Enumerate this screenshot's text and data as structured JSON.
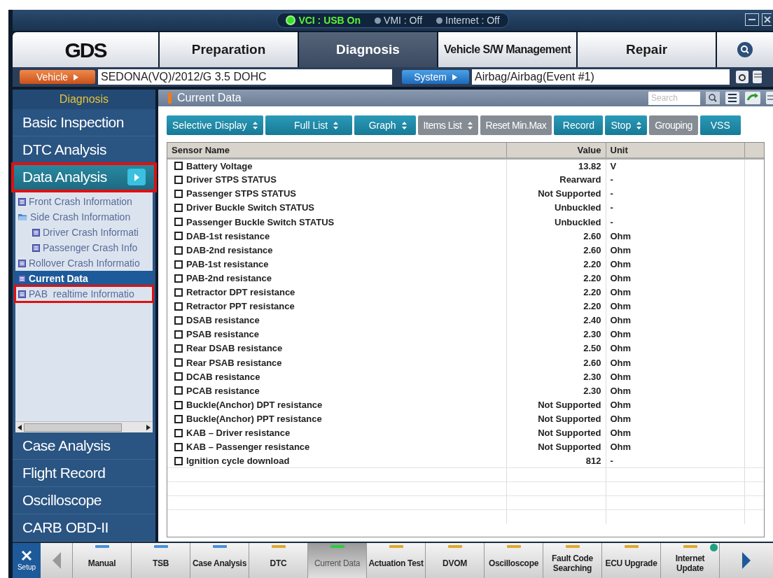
{
  "status_bar": {
    "indicators": [
      {
        "label": "VCI : USB On",
        "on": true
      },
      {
        "label": "VMI : Off",
        "on": false
      },
      {
        "label": "Internet : Off",
        "on": false
      }
    ]
  },
  "logo": "GDS",
  "tabs": [
    {
      "label": "Preparation",
      "selected": false
    },
    {
      "label": "Diagnosis",
      "selected": true
    },
    {
      "label": "Vehicle S/W Management",
      "selected": false
    },
    {
      "label": "Repair",
      "selected": false
    }
  ],
  "vehicle_bar": {
    "vehicle_button": "Vehicle",
    "vehicle_value": "SEDONA(VQ)/2012/G 3.5 DOHC",
    "system_button": "System",
    "system_value": "Airbag/Airbag(Event #1)"
  },
  "sidebar": {
    "title": "Diagnosis",
    "top_items": [
      {
        "label": "Basic Inspection",
        "selected": false,
        "highlighted": false
      },
      {
        "label": "DTC Analysis",
        "selected": false,
        "highlighted": false
      },
      {
        "label": "Data Analysis",
        "selected": true,
        "highlighted": true
      }
    ],
    "tree": [
      {
        "label": "Front Crash Information",
        "kind": "item",
        "selected": false,
        "highlighted": false
      },
      {
        "label": "Side Crash Information",
        "kind": "folder",
        "selected": false,
        "highlighted": false,
        "children": [
          {
            "label": "Driver Crash Informati",
            "kind": "item",
            "selected": false,
            "highlighted": false
          },
          {
            "label": "Passenger Crash Info",
            "kind": "item",
            "selected": false,
            "highlighted": false
          }
        ]
      },
      {
        "label": "Rollover Crash Informatio",
        "kind": "item",
        "selected": false,
        "highlighted": false
      },
      {
        "label": "Current Data",
        "kind": "item",
        "selected": true,
        "highlighted": false
      },
      {
        "label": "PAB  realtime Informatio",
        "kind": "item",
        "selected": false,
        "highlighted": true
      }
    ],
    "bottom_items": [
      {
        "label": "Case Analysis"
      },
      {
        "label": "Flight Record"
      },
      {
        "label": "Oscilloscope"
      },
      {
        "label": "CARB OBD-II"
      }
    ]
  },
  "panel": {
    "title": "Current Data",
    "search": {
      "placeholder": "Search"
    }
  },
  "toolbar": [
    {
      "label": "Selective Display",
      "dropdown": true,
      "disabled": false
    },
    {
      "label": "Full List",
      "dropdown": true,
      "disabled": false
    },
    {
      "label": "Graph",
      "dropdown": true,
      "disabled": false
    },
    {
      "label": "Items List",
      "dropdown": true,
      "disabled": true
    },
    {
      "label": "Reset Min.Max",
      "dropdown": false,
      "disabled": true
    },
    {
      "label": "Record",
      "dropdown": false,
      "disabled": false
    },
    {
      "label": "Stop",
      "dropdown": true,
      "disabled": false
    },
    {
      "label": "Grouping",
      "dropdown": false,
      "disabled": true
    },
    {
      "label": "VSS",
      "dropdown": false,
      "disabled": false
    }
  ],
  "table": {
    "columns": [
      "Sensor Name",
      "Value",
      "Unit"
    ],
    "rows": [
      {
        "name": "Battery Voltage",
        "value": "13.82",
        "unit": "V",
        "checked": false
      },
      {
        "name": "Driver STPS STATUS",
        "value": "Rearward",
        "unit": "-",
        "checked": false
      },
      {
        "name": "Passenger STPS STATUS",
        "value": "Not Supported",
        "unit": "-",
        "checked": false
      },
      {
        "name": "Driver Buckle Switch STATUS",
        "value": "Unbuckled",
        "unit": "-",
        "checked": false
      },
      {
        "name": "Passenger Buckle Switch STATUS",
        "value": "Unbuckled",
        "unit": "-",
        "checked": false
      },
      {
        "name": "DAB-1st resistance",
        "value": "2.60",
        "unit": "Ohm",
        "checked": false
      },
      {
        "name": "DAB-2nd resistance",
        "value": "2.60",
        "unit": "Ohm",
        "checked": false
      },
      {
        "name": "PAB-1st resistance",
        "value": "2.20",
        "unit": "Ohm",
        "checked": false
      },
      {
        "name": "PAB-2nd resistance",
        "value": "2.20",
        "unit": "Ohm",
        "checked": false
      },
      {
        "name": "Retractor DPT resistance",
        "value": "2.20",
        "unit": "Ohm",
        "checked": false
      },
      {
        "name": "Retractor PPT resistance",
        "value": "2.20",
        "unit": "Ohm",
        "checked": false
      },
      {
        "name": "DSAB resistance",
        "value": "2.40",
        "unit": "Ohm",
        "checked": false
      },
      {
        "name": "PSAB resistance",
        "value": "2.30",
        "unit": "Ohm",
        "checked": false
      },
      {
        "name": "Rear DSAB resistance",
        "value": "2.50",
        "unit": "Ohm",
        "checked": false
      },
      {
        "name": "Rear PSAB resistance",
        "value": "2.60",
        "unit": "Ohm",
        "checked": false
      },
      {
        "name": "DCAB resistance",
        "value": "2.30",
        "unit": "Ohm",
        "checked": false
      },
      {
        "name": "PCAB resistance",
        "value": "2.30",
        "unit": "Ohm",
        "checked": false
      },
      {
        "name": "Buckle(Anchor) DPT resistance",
        "value": "Not Supported",
        "unit": "Ohm",
        "checked": false
      },
      {
        "name": "Buckle(Anchor) PPT resistance",
        "value": "Not Supported",
        "unit": "Ohm",
        "checked": false
      },
      {
        "name": "KAB – Driver resistance",
        "value": "Not Supported",
        "unit": "Ohm",
        "checked": false
      },
      {
        "name": "KAB – Passenger resistance",
        "value": "Not Supported",
        "unit": "Ohm",
        "checked": false
      },
      {
        "name": "Ignition cycle download",
        "value": "812",
        "unit": "-",
        "checked": false
      }
    ]
  },
  "bottom_toolbar": {
    "setup": "Setup",
    "items": [
      {
        "label": "Manual",
        "color": "#4a90d9",
        "selected": false,
        "badge": false
      },
      {
        "label": "TSB",
        "color": "#4a90d9",
        "selected": false,
        "badge": false
      },
      {
        "label": "Case Analysis",
        "color": "#4a90d9",
        "selected": false,
        "badge": false
      },
      {
        "label": "DTC",
        "color": "#e0a82e",
        "selected": false,
        "badge": false
      },
      {
        "label": "Current Data",
        "color": "#2ecc40",
        "selected": true,
        "badge": false
      },
      {
        "label": "Actuation Test",
        "color": "#e0a82e",
        "selected": false,
        "badge": false
      },
      {
        "label": "DVOM",
        "color": "#e0a82e",
        "selected": false,
        "badge": false
      },
      {
        "label": "Oscilloscope",
        "color": "#e0a82e",
        "selected": false,
        "badge": false
      },
      {
        "label": "Fault Code Searching",
        "color": "#e0a82e",
        "selected": false,
        "badge": false
      },
      {
        "label": "ECU Upgrade",
        "color": "#e0a82e",
        "selected": false,
        "badge": false
      },
      {
        "label": "Internet Update",
        "color": "#e0a82e",
        "selected": false,
        "badge": true
      }
    ]
  }
}
